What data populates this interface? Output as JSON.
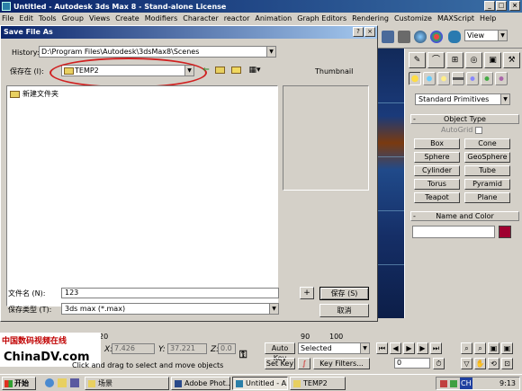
{
  "app": {
    "title": "Untitled - Autodesk 3ds Max 8  - Stand-alone License",
    "menus": [
      "File",
      "Edit",
      "Tools",
      "Group",
      "Views",
      "Create",
      "Modifiers",
      "Character",
      "reactor",
      "Animation",
      "Graph Editors",
      "Rendering",
      "Customize",
      "MAXScript",
      "Help"
    ],
    "view_dropdown": "View"
  },
  "dialog": {
    "title": "Save File As",
    "history_label": "History:",
    "history_value": "D:\\Program Files\\Autodesk\\3dsMax8\\Scenes",
    "save_in_label": "保存在 (I):",
    "save_in_value": "TEMP2",
    "thumbnail_label": "Thumbnail",
    "files": [
      {
        "name": "新建文件夹",
        "icon": "folder-icon"
      }
    ],
    "filename_label": "文件名 (N):",
    "filename_value": "123",
    "filetype_label": "保存类型 (T):",
    "filetype_value": "3ds max (*.max)",
    "plus_label": "+",
    "save_label": "保存 (S)",
    "cancel_label": "取消",
    "help_label": "?",
    "close_label": "×",
    "annotation_color": "#d02020"
  },
  "command_panel": {
    "tabs": [
      "create-tab",
      "modify-tab",
      "hierarchy-tab",
      "motion-tab",
      "display-tab",
      "utilities-tab"
    ],
    "primitive_dropdown": "Standard Primitives",
    "object_type_header": "Object Type",
    "autogrid_label": "AutoGrid",
    "objects": [
      "Box",
      "Cone",
      "Sphere",
      "GeoSphere",
      "Cylinder",
      "Tube",
      "Torus",
      "Pyramid",
      "Teapot",
      "Plane"
    ],
    "name_color_header": "Name and Color",
    "rollout_toggle": "-",
    "swatch_color": "#a00030"
  },
  "status": {
    "timeline_numbers": [
      "20",
      "90",
      "100"
    ],
    "x_label": "X:",
    "x_value": "7.426",
    "y_label": "Y:",
    "y_value": "37.221",
    "z_label": "Z:",
    "z_value": "0.0",
    "prompt": "Click and drag to select and move objects",
    "auto_key": "Auto Key",
    "set_key": "Set Key",
    "selected": "Selected",
    "key_filters": "Key Filters...",
    "frame": "0"
  },
  "watermark": {
    "cn": "中国数码视频在线",
    "en": "ChinaDV.com"
  },
  "taskbar": {
    "start": "开始",
    "tasks": [
      "场景",
      "Adobe Phot...",
      "Untitled - A...",
      "TEMP2"
    ],
    "tray_ime": "CH",
    "clock": "9:13"
  },
  "window_controls": {
    "minimize": "_",
    "maximize": "□",
    "close": "×"
  }
}
